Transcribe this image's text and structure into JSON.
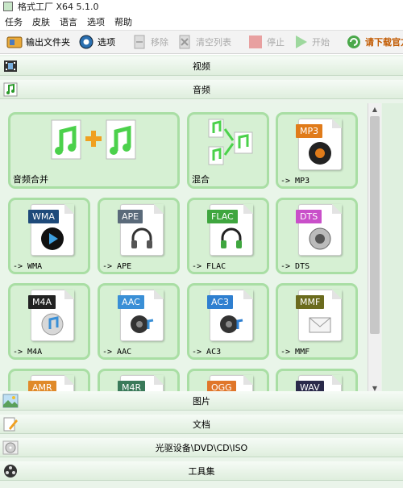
{
  "window": {
    "title": "格式工厂 X64 5.1.0"
  },
  "menu": [
    "任务",
    "皮肤",
    "语言",
    "选项",
    "帮助"
  ],
  "toolbar": {
    "output_folder": "输出文件夹",
    "options": "选项",
    "remove": "移除",
    "clear_list": "清空列表",
    "stop": "停止",
    "start": "开始",
    "download": "请下载官方正式"
  },
  "nav": {
    "video": "视频",
    "audio": "音频",
    "picture": "图片",
    "document": "文档",
    "rom": "光驱设备\\DVD\\CD\\ISO",
    "tools": "工具集"
  },
  "tiles": [
    {
      "label": "音频合并",
      "kind": "merge"
    },
    {
      "label": "混合",
      "kind": "mix"
    },
    {
      "label": "-> MP3",
      "tag": "MP3",
      "color": "#e07b1a"
    },
    {
      "label": "-> WMA",
      "tag": "WMA",
      "color": "#1e4a7a"
    },
    {
      "label": "-> APE",
      "tag": "APE",
      "color": "#5a6a7a"
    },
    {
      "label": "-> FLAC",
      "tag": "FLAC",
      "color": "#3fa63f"
    },
    {
      "label": "-> DTS",
      "tag": "DTS",
      "color": "#c94fc9"
    },
    {
      "label": "-> M4A",
      "tag": "M4A",
      "color": "#222222"
    },
    {
      "label": "-> AAC",
      "tag": "AAC",
      "color": "#3a8fd6"
    },
    {
      "label": "-> AC3",
      "tag": "AC3",
      "color": "#2f7fd0"
    },
    {
      "label": "-> MMF",
      "tag": "MMF",
      "color": "#6b6b1e"
    },
    {
      "label": "",
      "tag": "AMR",
      "color": "#e08a2a"
    },
    {
      "label": "",
      "tag": "M4R",
      "color": "#3a7a5a"
    },
    {
      "label": "",
      "tag": "OGG",
      "color": "#e0762a"
    },
    {
      "label": "",
      "tag": "WAV",
      "color": "#2a2a4a"
    }
  ]
}
